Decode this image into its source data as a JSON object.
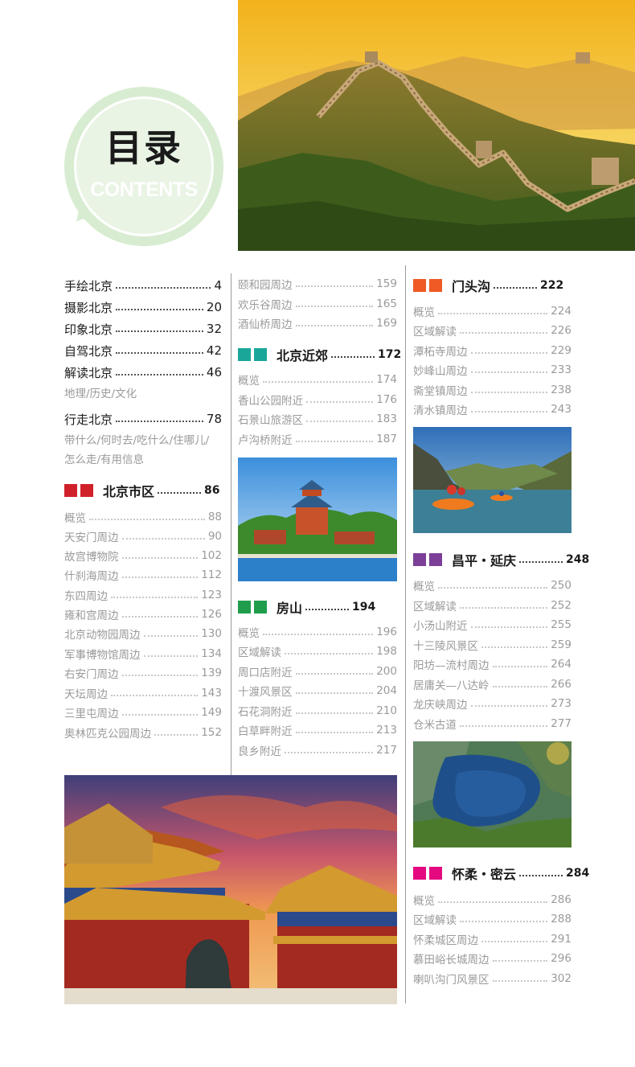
{
  "header": {
    "title": "目录",
    "subtitle": "CONTENTS"
  },
  "col1": {
    "main_items": [
      {
        "label": "手绘北京",
        "page": "4"
      },
      {
        "label": "摄影北京",
        "page": "20"
      },
      {
        "label": "印象北京",
        "page": "32"
      },
      {
        "label": "自驾北京",
        "page": "42"
      },
      {
        "label": "解读北京",
        "page": "46"
      }
    ],
    "note1": "地理/历史/文化",
    "main_item6": {
      "label": "行走北京",
      "page": "78"
    },
    "note2_line1": "带什么/何时去/吃什么/住哪儿/",
    "note2_line2": "怎么走/有用信息",
    "section": {
      "label": "北京市区",
      "page": "86",
      "color": "#d0212b"
    },
    "items": [
      {
        "label": "概览",
        "page": "88"
      },
      {
        "label": "天安门周边",
        "page": "90"
      },
      {
        "label": "故宫博物院",
        "page": "102"
      },
      {
        "label": "什刹海周边",
        "page": "112"
      },
      {
        "label": "东四周边",
        "page": "123"
      },
      {
        "label": "雍和宫周边",
        "page": "126"
      },
      {
        "label": "北京动物园周边",
        "page": "130"
      },
      {
        "label": "军事博物馆周边",
        "page": "134"
      },
      {
        "label": "右安门周边",
        "page": "139"
      },
      {
        "label": "天坛周边",
        "page": "143"
      },
      {
        "label": "三里屯周边",
        "page": "149"
      },
      {
        "label": "奥林匹克公园周边",
        "page": "152"
      }
    ]
  },
  "col2": {
    "top_items": [
      {
        "label": "颐和园周边",
        "page": "159"
      },
      {
        "label": "欢乐谷周边",
        "page": "165"
      },
      {
        "label": "酒仙桥周边",
        "page": "169"
      }
    ],
    "section1": {
      "label": "北京近郊",
      "page": "172",
      "color": "#1aa79a"
    },
    "items1": [
      {
        "label": "概览",
        "page": "174"
      },
      {
        "label": "香山公园附近",
        "page": "176"
      },
      {
        "label": "石景山旅游区",
        "page": "183"
      },
      {
        "label": "卢沟桥附近",
        "page": "187"
      }
    ],
    "section2": {
      "label": "房山",
      "page": "194",
      "color": "#1f9d4c"
    },
    "items2": [
      {
        "label": "概览",
        "page": "196"
      },
      {
        "label": "区域解读",
        "page": "198"
      },
      {
        "label": "周口店附近",
        "page": "200"
      },
      {
        "label": "十渡风景区",
        "page": "204"
      },
      {
        "label": "石花洞附近",
        "page": "210"
      },
      {
        "label": "白草畔附近",
        "page": "213"
      },
      {
        "label": "良乡附近",
        "page": "217"
      }
    ]
  },
  "col3": {
    "section1": {
      "label": "门头沟",
      "page": "222",
      "color": "#ef5a25"
    },
    "items1": [
      {
        "label": "概览",
        "page": "224"
      },
      {
        "label": "区域解读",
        "page": "226"
      },
      {
        "label": "潭柘寺周边",
        "page": "229"
      },
      {
        "label": "妙峰山周边",
        "page": "233"
      },
      {
        "label": "斋堂镇周边",
        "page": "238"
      },
      {
        "label": "清水镇周边",
        "page": "243"
      }
    ],
    "section2": {
      "label": "昌平・延庆",
      "page": "248",
      "color": "#7b3f98"
    },
    "items2": [
      {
        "label": "概览",
        "page": "250"
      },
      {
        "label": "区域解读",
        "page": "252"
      },
      {
        "label": "小汤山附近",
        "page": "255"
      },
      {
        "label": "十三陵风景区",
        "page": "259"
      },
      {
        "label": "阳坊—流村周边",
        "page": "264"
      },
      {
        "label": "居庸关—八达岭",
        "page": "266"
      },
      {
        "label": "龙庆峡周边",
        "page": "273"
      },
      {
        "label": "仓米古道",
        "page": "277"
      }
    ],
    "section3": {
      "label": "怀柔・密云",
      "page": "284",
      "color": "#e5097f"
    },
    "items3": [
      {
        "label": "概览",
        "page": "286"
      },
      {
        "label": "区域解读",
        "page": "288"
      },
      {
        "label": "怀柔城区周边",
        "page": "291"
      },
      {
        "label": "慕田峪长城周边",
        "page": "296"
      },
      {
        "label": "喇叭沟门风景区",
        "page": "302"
      }
    ]
  }
}
